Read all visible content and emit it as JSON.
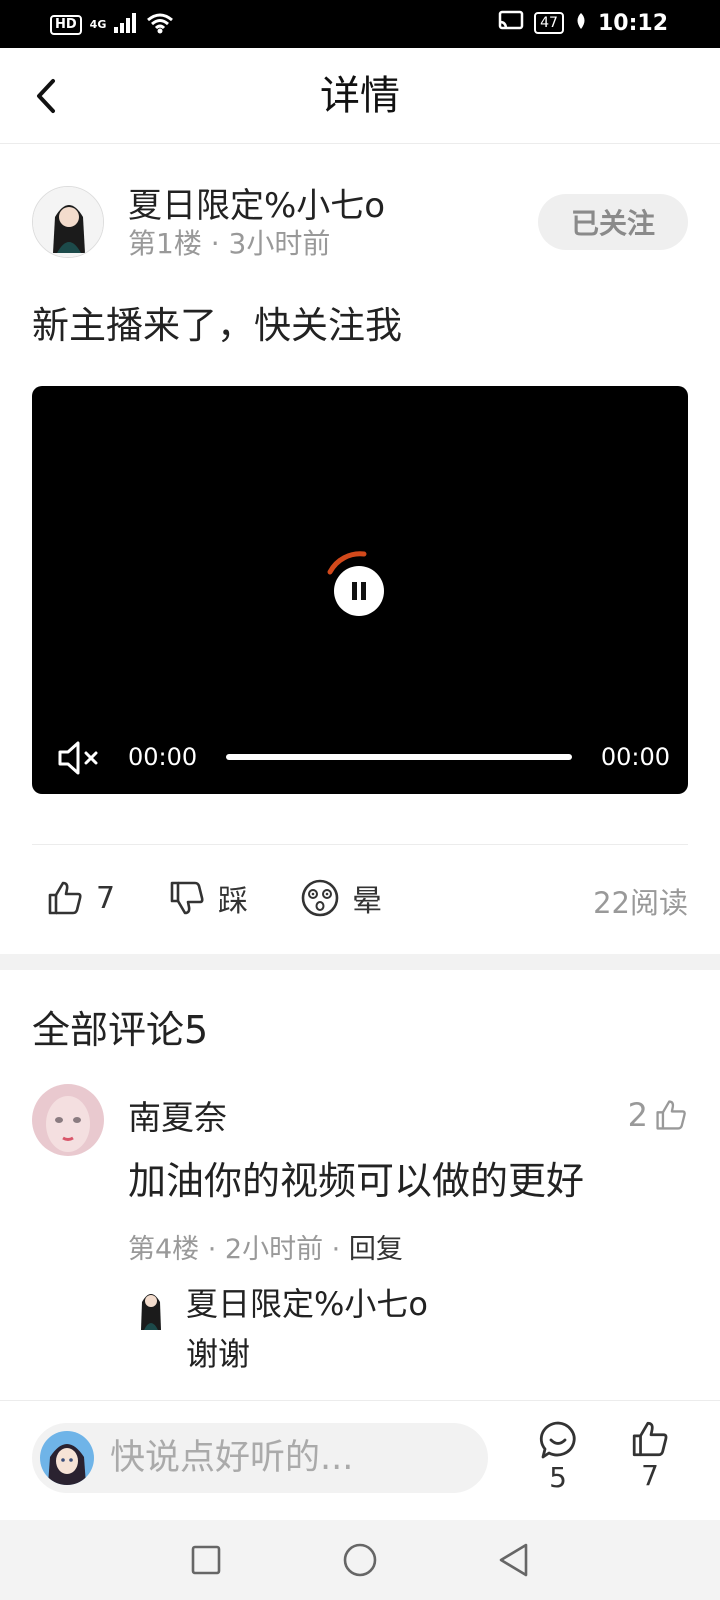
{
  "status_bar": {
    "hd": "HD",
    "network": "4G",
    "battery": "47",
    "time": "10:12"
  },
  "header": {
    "title": "详情"
  },
  "post": {
    "author": "夏日限定%小七o",
    "meta": "第1楼 · 3小时前",
    "follow_label": "已关注",
    "text": "新主播来了，快关注我",
    "video": {
      "current_time": "00:00",
      "total_time": "00:00"
    },
    "actions": {
      "like_count": "7",
      "dislike_label": "踩",
      "dizzy_label": "晕",
      "read_count": "22阅读"
    }
  },
  "comments": {
    "title": "全部评论5",
    "items": [
      {
        "author": "南夏奈",
        "likes": "2",
        "text": "加油你的视频可以做的更好",
        "meta": "第4楼 · 2小时前 · ",
        "reply_label": "回复",
        "reply": {
          "author": "夏日限定%小七o",
          "text": "谢谢"
        }
      }
    ]
  },
  "bottom_bar": {
    "placeholder": "快说点好听的...",
    "comment_count": "5",
    "like_count": "7"
  },
  "colors": {
    "accent_arc": "#d2491b",
    "muted_text": "#999999",
    "follow_bg": "#efefef"
  }
}
